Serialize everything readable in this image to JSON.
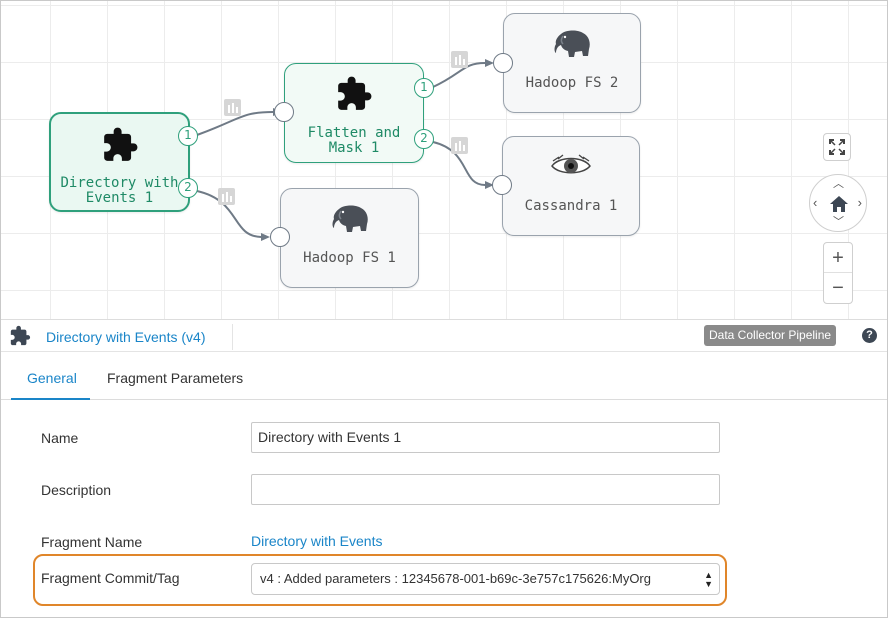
{
  "canvas": {
    "nodes": [
      {
        "id": "directory",
        "label_line1": "Directory with",
        "label_line2": "Events 1",
        "icon": "puzzle-icon",
        "out_ports": [
          "1",
          "2"
        ]
      },
      {
        "id": "flatten",
        "label_line1": "Flatten and",
        "label_line2": "Mask 1",
        "icon": "puzzle-icon",
        "out_ports": [
          "1",
          "2"
        ]
      },
      {
        "id": "hadoop2",
        "label_line1": "Hadoop FS 2",
        "icon": "hadoop-elephant-icon"
      },
      {
        "id": "cassandra",
        "label_line1": "Cassandra 1",
        "icon": "cassandra-eye-icon"
      },
      {
        "id": "hadoop1",
        "label_line1": "Hadoop FS 1",
        "icon": "hadoop-elephant-icon"
      }
    ],
    "controls": {
      "fit_icon": "expand-icon",
      "home_icon": "home-icon",
      "zoom_in": "+",
      "zoom_out": "−"
    }
  },
  "header": {
    "title": "Directory with Events (v4)",
    "badge": "Data Collector Pipeline",
    "help": "?"
  },
  "tabs": [
    {
      "label": "General",
      "active": true
    },
    {
      "label": "Fragment Parameters",
      "active": false
    }
  ],
  "form": {
    "name_label": "Name",
    "name_value": "Directory with Events 1",
    "description_label": "Description",
    "description_value": "",
    "fragment_name_label": "Fragment Name",
    "fragment_name_value": "Directory with Events",
    "commit_label": "Fragment Commit/Tag",
    "commit_value": "v4 : Added parameters : 12345678-001-b69c-3e757c175626:MyOrg"
  },
  "colors": {
    "accent": "#1a85c8",
    "stage_green": "#2fa07c",
    "highlight": "#e0862a"
  }
}
